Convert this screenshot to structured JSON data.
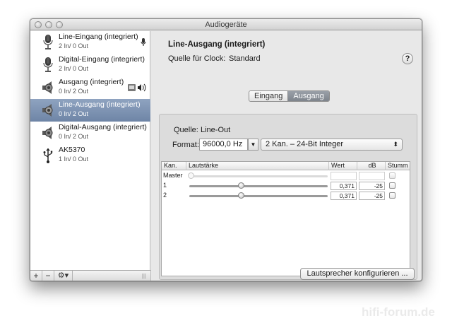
{
  "window": {
    "title": "Audiogeräte"
  },
  "sidebar": {
    "devices": [
      {
        "name": "Line-Eingang (integriert)",
        "io": "2 In/ 0 Out",
        "icon": "microphone-icon",
        "right_icon": "mic-input-indicator-icon"
      },
      {
        "name": "Digital-Eingang (integriert)",
        "io": "2 In/ 0 Out",
        "icon": "microphone-icon"
      },
      {
        "name": "Ausgang (integriert)",
        "io": "0 In/ 2 Out",
        "icon": "speaker-icon",
        "right_icon": "finder-speaker-default-icons"
      },
      {
        "name": "Line-Ausgang (integriert)",
        "io": "0 In/ 2 Out",
        "icon": "speaker-icon",
        "selected": true
      },
      {
        "name": "Digital-Ausgang (integriert)",
        "io": "0 In/ 2 Out",
        "icon": "speaker-icon"
      },
      {
        "name": "AK5370",
        "io": "1 In/ 0 Out",
        "icon": "usb-icon"
      }
    ],
    "bottom_buttons": {
      "add": "+",
      "remove": "−",
      "gear": "⚙▾"
    }
  },
  "detail": {
    "device_title": "Line-Ausgang (integriert)",
    "clock_label": "Quelle für Clock:",
    "clock_value": "Standard",
    "help": "?",
    "tabs": [
      {
        "label": "Eingang",
        "active": false
      },
      {
        "label": "Ausgang",
        "active": true
      }
    ],
    "quelle_label": "Quelle:",
    "quelle_value": "Line-Out",
    "format_label": "Format:",
    "sample_rate": "96000,0 Hz",
    "format_value": "2 Kan. – 24-Bit Integer",
    "table": {
      "headers": [
        "Kan.",
        "Lautstärke",
        "Wert",
        "dB",
        "Stumm"
      ],
      "rows": [
        {
          "channel": "Master",
          "level": 0.0,
          "value": "",
          "db": "",
          "mute": false,
          "enabled": false
        },
        {
          "channel": "1",
          "level": 0.371,
          "value": "0,371",
          "db": "-25",
          "mute": false,
          "enabled": true
        },
        {
          "channel": "2",
          "level": 0.371,
          "value": "0,371",
          "db": "-25",
          "mute": false,
          "enabled": true
        }
      ]
    },
    "configure_button": "Lautsprecher konfigurieren ..."
  },
  "watermark": "hifi-forum.de",
  "colors": {
    "selection": "#7b90b0",
    "window_bg": "#e8e8e8",
    "group_bg": "#dcdcdc"
  }
}
